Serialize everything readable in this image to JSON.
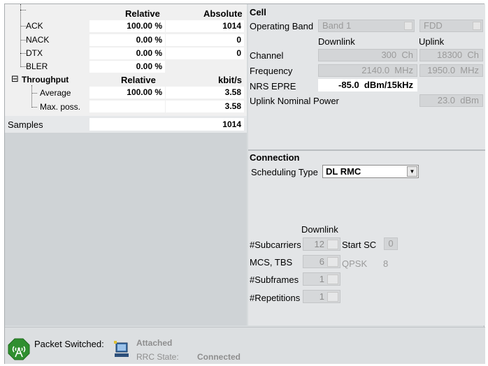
{
  "left": {
    "headers": {
      "relative": "Relative",
      "absolute": "Absolute"
    },
    "rows": [
      {
        "label": "ACK",
        "relative": "100.00 %",
        "absolute": "1014"
      },
      {
        "label": "NACK",
        "relative": "0.00 %",
        "absolute": "0"
      },
      {
        "label": "DTX",
        "relative": "0.00 %",
        "absolute": "0"
      },
      {
        "label": "BLER",
        "relative": "0.00 %",
        "absolute": ""
      }
    ],
    "throughput": {
      "label": "Throughput",
      "expander": "⊟",
      "relative_header": "Relative",
      "unit_header": "kbit/s",
      "average": {
        "label": "Average",
        "relative": "100.00 %",
        "value": "3.58"
      },
      "max": {
        "label": "Max. poss.",
        "value": "3.58"
      }
    },
    "samples": {
      "label": "Samples",
      "value": "1014"
    }
  },
  "cell": {
    "title": "Cell",
    "operating_band_label": "Operating Band",
    "operating_band_value": "Band 1",
    "duplex_value": "FDD",
    "downlink_header": "Downlink",
    "uplink_header": "Uplink",
    "channel_label": "Channel",
    "channel_dl": "300",
    "channel_dl_unit": "Ch",
    "channel_ul": "18300",
    "channel_ul_unit": "Ch",
    "frequency_label": "Frequency",
    "frequency_dl": "2140.0",
    "frequency_dl_unit": "MHz",
    "frequency_ul": "1950.0",
    "frequency_ul_unit": "MHz",
    "nrs_label": "NRS EPRE",
    "nrs_value": "-85.0",
    "nrs_unit": "dBm/15kHz",
    "ul_power_label": "Uplink Nominal Power",
    "ul_power_value": "23.0",
    "ul_power_unit": "dBm"
  },
  "connection": {
    "title": "Connection",
    "scheduling_label": "Scheduling Type",
    "scheduling_value": "DL RMC",
    "downlink_header": "Downlink",
    "subcarriers_label": "#Subcarriers",
    "subcarriers_value": "12",
    "start_sc_label": "Start SC",
    "start_sc_value": "0",
    "mcs_label": "MCS, TBS",
    "mcs_value": "6",
    "modulation": "QPSK",
    "tbs_value": "8",
    "subframes_label": "#Subframes",
    "subframes_value": "1",
    "repetitions_label": "#Repetitions",
    "repetitions_value": "1"
  },
  "status": {
    "packet_switched_label": "Packet Switched:",
    "attached": "Attached",
    "rrc_label": "RRC State:",
    "rrc_value": "Connected"
  },
  "icons": {
    "antenna": "antenna-icon",
    "network": "network-status-icon"
  },
  "colors": {
    "antenna_green": "#2f8f2f",
    "panel": "#d7dbdd"
  }
}
